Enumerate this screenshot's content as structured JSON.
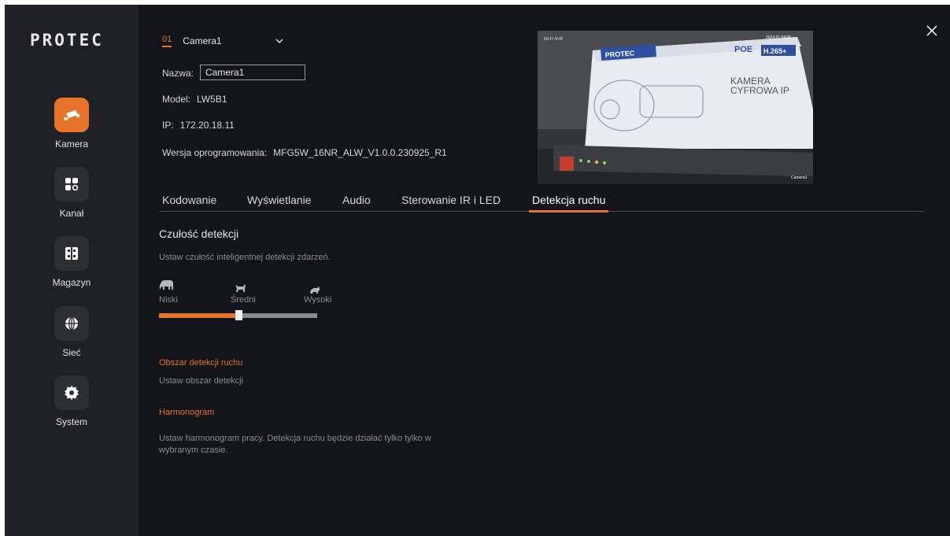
{
  "sidebar": {
    "logo": "PROTEC",
    "items": [
      {
        "label": "Kamera",
        "icon": "camera-icon",
        "active": true
      },
      {
        "label": "Kanał",
        "icon": "grid-icon",
        "active": false
      },
      {
        "label": "Magazyn",
        "icon": "storage-icon",
        "active": false
      },
      {
        "label": "Sieć",
        "icon": "globe-icon",
        "active": false
      },
      {
        "label": "System",
        "icon": "gear-icon",
        "active": false
      }
    ]
  },
  "camera": {
    "number": "01",
    "selected": "Camera1",
    "name_label": "Nazwa:",
    "name_value": "Camera1",
    "model_label": "Model:",
    "model_value": "LW5B1",
    "ip_label": "IP:",
    "ip_value": "172.20.18.11",
    "firmware_label": "Wersja oprogramowania:",
    "firmware_value": "MFG5W_16NR_ALW_V1.0.0.230925_R1"
  },
  "preview": {
    "timestamp": "2024 01:54:05",
    "nvr_label": "WI-FI NVR",
    "channel_label": "Camera1",
    "box_logo": "PROTEC",
    "box_poe": "POE",
    "box_h265": "H.265+",
    "box_title_line1": "KAMERA",
    "box_title_line2": "CYFROWA IP"
  },
  "tabs": [
    {
      "label": "Kodowanie",
      "active": false
    },
    {
      "label": "Wyświetlanie",
      "active": false
    },
    {
      "label": "Audio",
      "active": false
    },
    {
      "label": "Sterowanie IR i LED",
      "active": false
    },
    {
      "label": "Detekcja ruchu",
      "active": true
    }
  ],
  "detection": {
    "title": "Czułość detekcji",
    "description": "Ustaw czułość inteligentnej detekcji zdarzeń.",
    "levels": [
      "Niski",
      "Średni",
      "Wysoki"
    ],
    "level_icons": [
      "elephant-icon",
      "dog-icon",
      "mouse-icon"
    ],
    "slider_value": 0.5
  },
  "area": {
    "title": "Obszar detekcji ruchu",
    "description": "Ustaw obszar detekcji"
  },
  "schedule": {
    "title": "Harmonogram",
    "description_line1": "Ustaw harmonogram pracy. Detekcja ruchu będzie działać tylko tylko w",
    "description_line2": "wybranym czasie."
  },
  "colors": {
    "accent": "#e8732b",
    "background": "#14151a",
    "sidebar": "#202126"
  }
}
